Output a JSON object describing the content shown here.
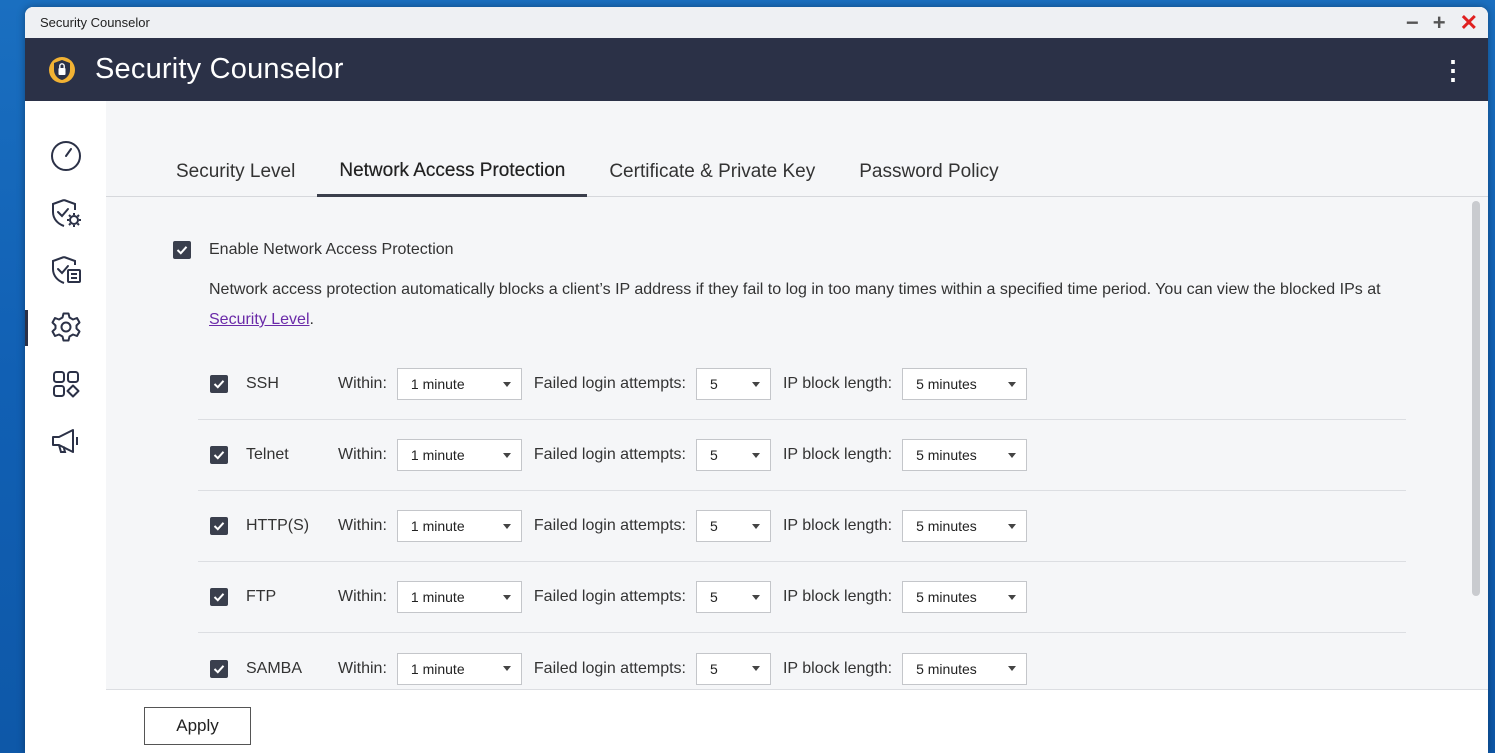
{
  "window": {
    "title": "Security Counselor",
    "controls": {
      "minimize": "−",
      "maximize": "+",
      "close": "✕"
    }
  },
  "app": {
    "title": "Security Counselor",
    "menu_icon": "⋮"
  },
  "sidebar": {
    "items": [
      {
        "icon": "gauge-icon"
      },
      {
        "icon": "shield-gear-icon"
      },
      {
        "icon": "shield-list-icon"
      },
      {
        "icon": "settings-gear-icon",
        "active": true
      },
      {
        "icon": "apps-grid-icon"
      },
      {
        "icon": "megaphone-icon"
      }
    ]
  },
  "tabs": [
    {
      "label": "Security Level"
    },
    {
      "label": "Network Access Protection",
      "active": true
    },
    {
      "label": "Certificate & Private Key"
    },
    {
      "label": "Password Policy"
    }
  ],
  "protection": {
    "enable_label": "Enable Network Access Protection",
    "enabled": true,
    "description_text": "Network access protection automatically blocks a client’s IP address if they fail to log in too many times within a specified time period. You can view the blocked IPs at ",
    "description_link": "Security Level",
    "description_end": "."
  },
  "labels": {
    "within": "Within:",
    "failed": "Failed login attempts:",
    "block": "IP block length:"
  },
  "services": [
    {
      "name": "SSH",
      "checked": true,
      "within": "1 minute",
      "attempts": "5",
      "block": "5 minutes"
    },
    {
      "name": "Telnet",
      "checked": true,
      "within": "1 minute",
      "attempts": "5",
      "block": "5 minutes"
    },
    {
      "name": "HTTP(S)",
      "checked": true,
      "within": "1 minute",
      "attempts": "5",
      "block": "5 minutes"
    },
    {
      "name": "FTP",
      "checked": true,
      "within": "1 minute",
      "attempts": "5",
      "block": "5 minutes"
    },
    {
      "name": "SAMBA",
      "checked": true,
      "within": "1 minute",
      "attempts": "5",
      "block": "5 minutes"
    }
  ],
  "footer": {
    "apply_label": "Apply"
  },
  "colors": {
    "header_bg": "#2b3147",
    "checkbox": "#3a3f4d",
    "link": "#6a2aa8",
    "desktop_bg": "#1160b4",
    "close": "#e02020"
  }
}
